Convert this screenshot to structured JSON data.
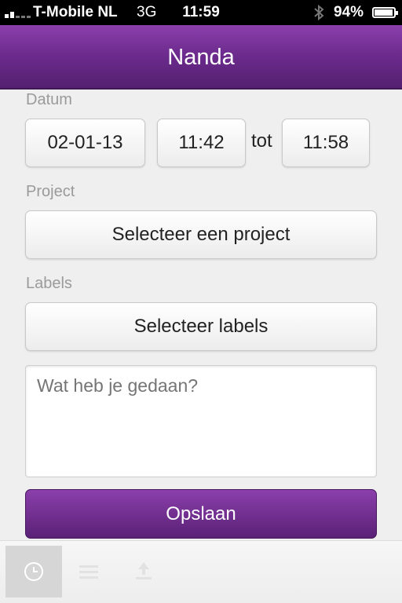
{
  "status_bar": {
    "carrier": "T-Mobile NL",
    "network": "3G",
    "time": "11:59",
    "battery_text": "94%",
    "battery_level": 0.94
  },
  "nav": {
    "title": "Nanda"
  },
  "form": {
    "date_label": "Datum",
    "date_value": "02-01-13",
    "start_time": "11:42",
    "to_label": "tot",
    "end_time": "11:58",
    "project_label": "Project",
    "project_button": "Selecteer een project",
    "labels_label": "Labels",
    "labels_button": "Selecteer labels",
    "description_placeholder": "Wat heb je gedaan?",
    "save_button": "Opslaan"
  },
  "tabs": [
    {
      "icon": "clock-icon",
      "active": true
    },
    {
      "icon": "list-icon",
      "active": false
    },
    {
      "icon": "upload-icon",
      "active": false
    }
  ],
  "colors": {
    "accent": "#6b2a8c",
    "accent_dark": "#54206f"
  }
}
